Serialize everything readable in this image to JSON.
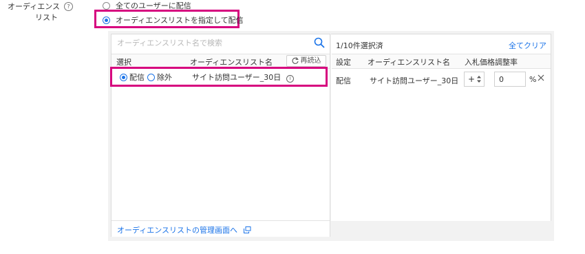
{
  "field": {
    "label_line1": "オーディエンス",
    "label_line2": "リスト",
    "help_glyph": "?"
  },
  "options": [
    {
      "label": "全てのユーザーに配信",
      "selected": false
    },
    {
      "label": "オーディエンスリストを指定して配信",
      "selected": true
    }
  ],
  "search": {
    "placeholder": "オーディエンスリスト名で検索"
  },
  "left_table": {
    "headers": {
      "select": "選択",
      "name": "オーディエンスリスト名"
    },
    "reload_label": "再読込",
    "rows": [
      {
        "include_label": "配信",
        "exclude_label": "除外",
        "name": "サイト訪問ユーザー_30日",
        "mode": "include"
      }
    ],
    "footer_link": "オーディエンスリストの管理画面へ"
  },
  "right_table": {
    "selection_count": "1/10件選択済",
    "clear_all": "全てクリア",
    "headers": {
      "setting": "設定",
      "name": "オーディエンスリスト名",
      "bid": "入札価格調整率"
    },
    "rows": [
      {
        "setting": "配信",
        "name": "サイト訪問ユーザー_30日",
        "sign": "+",
        "value": "0",
        "unit": "%"
      }
    ]
  },
  "colors": {
    "accent": "#1a73e8",
    "highlight": "#d6007e"
  }
}
